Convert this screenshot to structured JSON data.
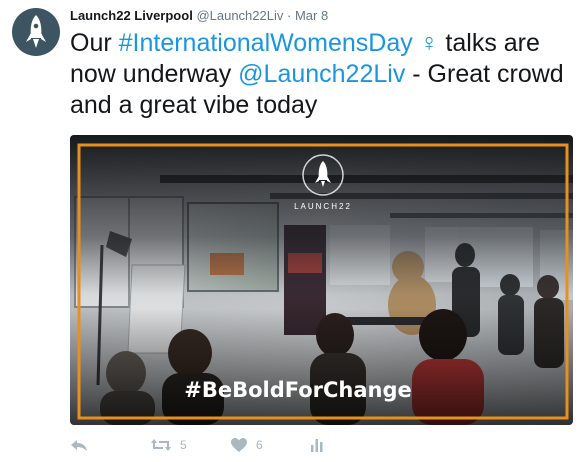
{
  "tweet": {
    "author_name": "Launch22 Liverpool",
    "author_handle": "@Launch22Liv",
    "separator": "·",
    "date": "Mar 8",
    "text_prefix": "Our ",
    "hashtag_iwd": "#InternationalWomensDay",
    "venus_symbol": "♀",
    "text_mid": " talks are now underway ",
    "mention": "@Launch22Liv",
    "text_suffix": " - Great crowd and a great vibe today"
  },
  "media": {
    "logo_text": "LAUNCH22",
    "overlay_hashtag": "#BeBoldForChange",
    "frame_color": "#e8901e",
    "description_alt": ""
  },
  "actions": {
    "reply_icon": "reply-icon",
    "retweet_icon": "retweet-icon",
    "retweet_count": "5",
    "like_icon": "heart-icon",
    "like_count": "6",
    "analytics_icon": "analytics-icon"
  },
  "colors": {
    "link": "#1b95e0",
    "muted": "#657786",
    "action": "#aab8c2",
    "avatar_bg": "#3d5463"
  }
}
